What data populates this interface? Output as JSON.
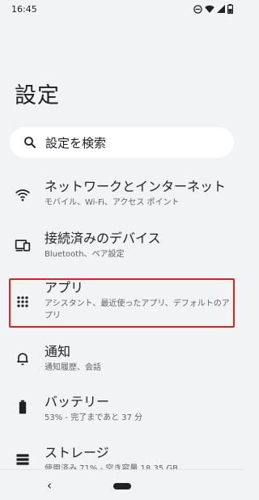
{
  "status_bar": {
    "time": "16:45",
    "icons": [
      "dnd-icon",
      "wifi-icon",
      "signal-icon",
      "battery-icon"
    ]
  },
  "page": {
    "title": "設定"
  },
  "search": {
    "label": "設定を検索",
    "icon": "search-icon"
  },
  "items": [
    {
      "title": "ネットワークとインターネット",
      "subtitle": "モバイル、Wi-Fi、アクセス ポイント",
      "icon": "wifi-icon"
    },
    {
      "title": "接続済みのデバイス",
      "subtitle": "Bluetooth、ペア設定",
      "icon": "devices-icon"
    },
    {
      "title": "アプリ",
      "subtitle": "アシスタント、最近使ったアプリ、デフォルトのアプリ",
      "icon": "apps-grid-icon"
    },
    {
      "title": "通知",
      "subtitle": "通知履歴、会話",
      "icon": "bell-icon"
    },
    {
      "title": "バッテリー",
      "subtitle": "53% - 完了まであと 37 分",
      "icon": "battery-icon"
    },
    {
      "title": "ストレージ",
      "subtitle": "使用済み 71% - 空き容量 18.35 GB",
      "icon": "storage-icon"
    }
  ],
  "nav_bar": {
    "back_label": "‹"
  },
  "colors": {
    "background": "#f1f3f4",
    "highlight": "#e0231c",
    "text": "#202124",
    "subtext": "#5f6368"
  }
}
